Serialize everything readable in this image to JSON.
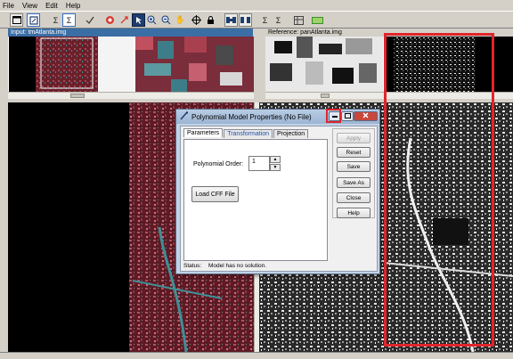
{
  "menu": [
    "File",
    "View",
    "Edit",
    "Help"
  ],
  "panes": {
    "input_title": "Input: tmAtlanta.img",
    "reference_title": "Reference: panAtlanta.img"
  },
  "toolbar_icons": [
    "window-icon",
    "link-icon",
    "sigma-icon",
    "sigma-settings-icon",
    "checkmark-icon",
    "target-icon",
    "create-point-icon",
    "select-arrow-icon",
    "zoom-in-icon",
    "zoom-out-icon",
    "pan-hand-icon",
    "crosshair-icon",
    "lock-icon",
    "link-viewers-icon",
    "unlink-viewers-icon",
    "sigma-icon",
    "sigma-auto-icon",
    "grid-icon",
    "ruler-icon"
  ],
  "colors": {
    "highlight_red": "#e0262b",
    "dialog_frame": "#c3d3e6",
    "title_blue": "#3a6ea5"
  },
  "dialog": {
    "title": "Polynomial Model Properties (No File)",
    "tabs": [
      "Parameters",
      "Transformation",
      "Projection"
    ],
    "active_tab": "Parameters",
    "polynomial_order_label": "Polynomial Order:",
    "polynomial_order_value": "1",
    "load_cff_label": "Load CFF File",
    "buttons": {
      "apply": "Apply",
      "reset": "Reset",
      "save": "Save",
      "save_as": "Save As",
      "close": "Close",
      "help": "Help"
    },
    "status_label": "Status:",
    "status_text": "Model has no solution."
  }
}
